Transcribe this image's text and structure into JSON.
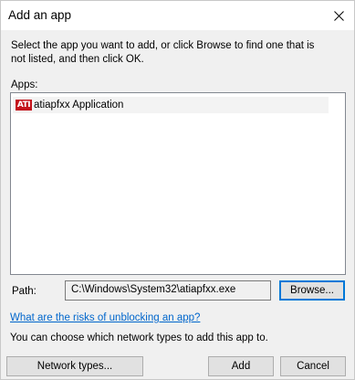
{
  "window": {
    "title": "Add an app"
  },
  "dialog": {
    "instructions": "Select the app you want to add, or click Browse to find one that is not listed, and then click OK.",
    "apps_label": "Apps:",
    "apps": [
      {
        "icon": "ati-app-icon",
        "icon_text": "ATI",
        "name": "atiapfxx Application",
        "selected": true
      }
    ],
    "path_label": "Path:",
    "path_value": "C:\\Windows\\System32\\atiapfxx.exe",
    "browse_label": "Browse...",
    "risks_link": "What are the risks of unblocking an app?",
    "network_note": "You can choose which network types to add this app to.",
    "network_types_label": "Network types...",
    "add_label": "Add",
    "cancel_label": "Cancel"
  },
  "colors": {
    "link": "#0066cc",
    "focus_border": "#0078d7",
    "app_icon_bg": "#c4141c",
    "dialog_bg": "#f0f0f0"
  }
}
